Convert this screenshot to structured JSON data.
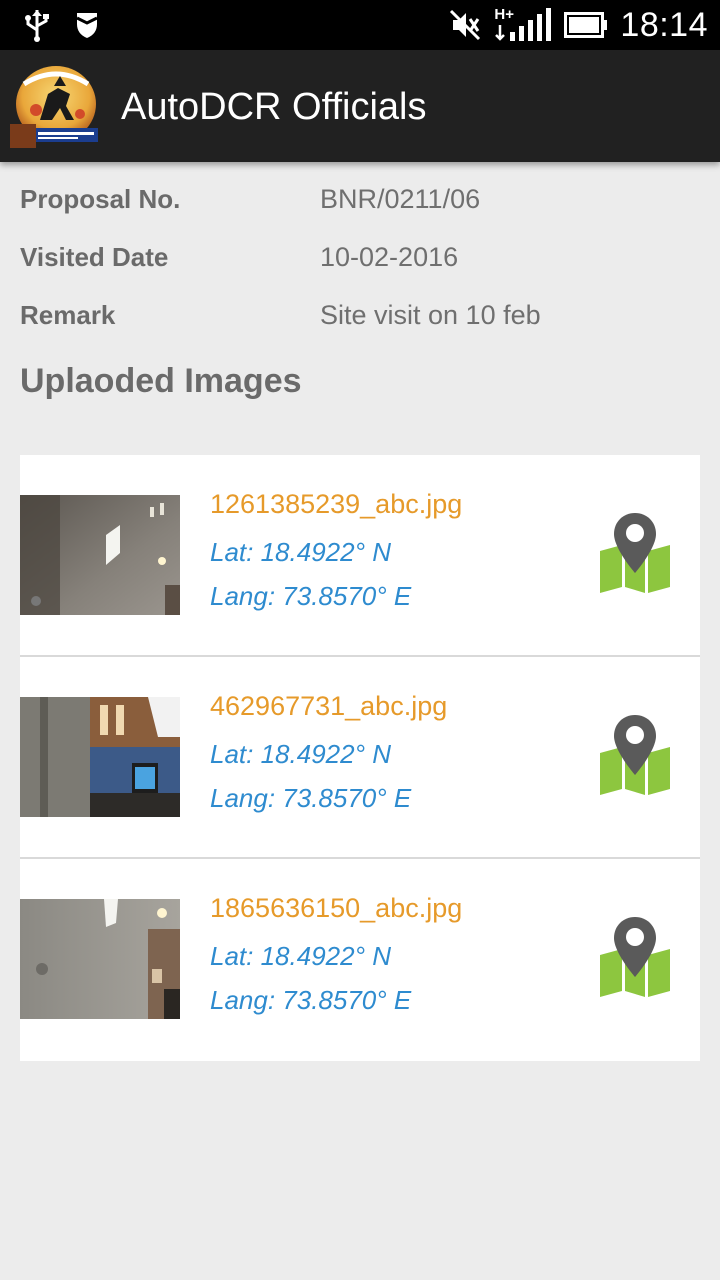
{
  "status_bar": {
    "time": "18:14",
    "network_label": "H+",
    "icons": [
      "usb-icon",
      "shield-icon",
      "mute-icon",
      "signal-icon",
      "battery-icon"
    ]
  },
  "app": {
    "title": "AutoDCR Officials"
  },
  "details": {
    "proposal_label": "Proposal No.",
    "proposal_value": "BNR/0211/06",
    "date_label": "Visited Date",
    "date_value": "10-02-2016",
    "remark_label": "Remark",
    "remark_value": "Site visit on 10 feb"
  },
  "uploads": {
    "title": "Uplaoded Images",
    "items": [
      {
        "file_name": "1261385239_abc.jpg",
        "lat": "Lat: 18.4922° N",
        "lang": "Lang: 73.8570° E",
        "icon": "map-pin-icon"
      },
      {
        "file_name": "462967731_abc.jpg",
        "lat": "Lat: 18.4922° N",
        "lang": "Lang: 73.8570° E",
        "icon": "map-pin-icon"
      },
      {
        "file_name": "1865636150_abc.jpg",
        "lat": "Lat: 18.4922° N",
        "lang": "Lang: 73.8570° E",
        "icon": "map-pin-icon"
      }
    ]
  },
  "colors": {
    "app_bar": "#212121",
    "file_name": "#e69a2a",
    "coords": "#2e8bcf",
    "map_green": "#8dc63f",
    "pin_gray": "#5a5a5a"
  }
}
